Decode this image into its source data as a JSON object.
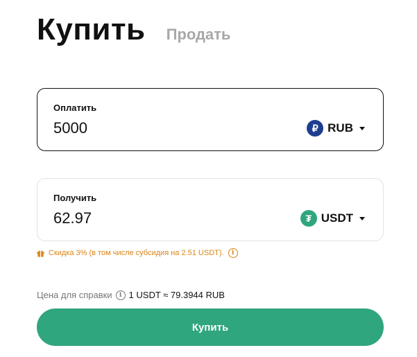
{
  "tabs": {
    "buy": "Купить",
    "sell": "Продать"
  },
  "pay": {
    "label": "Оплатить",
    "amount": "5000",
    "currency": "RUB",
    "currency_symbol": "₽",
    "currency_icon": "ruble-icon",
    "icon_color": "#1d3e8f"
  },
  "receive": {
    "label": "Получить",
    "amount": "62.97",
    "currency": "USDT",
    "currency_symbol": "₮",
    "currency_icon": "tether-icon",
    "icon_color": "#2fa67e"
  },
  "discount": {
    "text": "Скидка 3% (в том числе субсидия на 2.51 USDT).",
    "icon": "gift-icon",
    "color": "#d98518"
  },
  "rate": {
    "label": "Цена для справки",
    "value": "1 USDT ≈ 79.3944 RUB"
  },
  "buy_button": {
    "label": "Купить",
    "color": "#2fa67e"
  }
}
